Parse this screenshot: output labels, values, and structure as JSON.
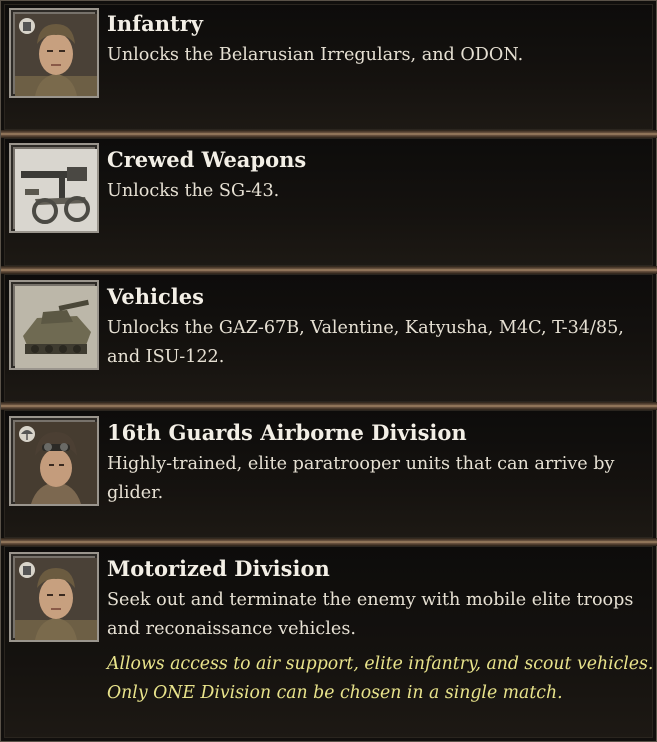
{
  "unlocks": [
    {
      "icon": "infantry-soldier-portrait-icon",
      "title": "Infantry",
      "description": "Unlocks the Belarusian Irregulars, and ODON."
    },
    {
      "icon": "crewed-weapon-machine-gun-icon",
      "title": "Crewed Weapons",
      "description": "Unlocks the SG-43."
    },
    {
      "icon": "vehicle-tank-icon",
      "title": "Vehicles",
      "description": "Unlocks the GAZ-67B, Valentine, Katyusha, M4C, T-34/85, and ISU-122."
    },
    {
      "icon": "airborne-paratrooper-portrait-icon",
      "title": "16th Guards Airborne Division",
      "description": "Highly-trained, elite paratrooper units that can arrive by glider."
    },
    {
      "icon": "motorized-division-soldier-portrait-icon",
      "title": "Motorized Division",
      "description": "Seek out and terminate the enemy with mobile elite troops and reconaissance vehicles.",
      "note": "Allows access to air support, elite infantry, and scout vehicles. Only ONE Division can be chosen in a single match."
    }
  ],
  "colors": {
    "title": "#f3efe6",
    "description": "#e6e0d3",
    "note": "#e8e38b",
    "divider": "#a88a6a"
  }
}
